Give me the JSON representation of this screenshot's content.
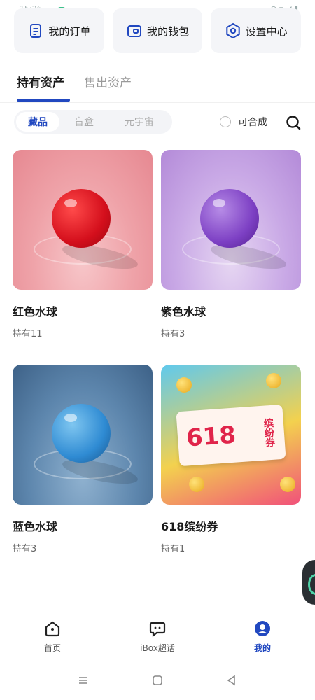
{
  "status_bar": {
    "time": "15:26",
    "right": "⊙ ▾ ◢ ▮"
  },
  "quick_actions": [
    {
      "label": "我的订单",
      "icon": "order-list-icon"
    },
    {
      "label": "我的钱包",
      "icon": "wallet-icon"
    },
    {
      "label": "设置中心",
      "icon": "settings-icon"
    }
  ],
  "asset_tabs": [
    {
      "label": "持有资产",
      "active": true
    },
    {
      "label": "售出资产",
      "active": false
    }
  ],
  "categories": [
    {
      "label": "藏品",
      "active": true
    },
    {
      "label": "盲盒",
      "active": false
    },
    {
      "label": "元宇宙",
      "active": false
    }
  ],
  "combine_filter": {
    "label": "可合成",
    "checked": false
  },
  "items": [
    {
      "title": "红色水球",
      "holding": "持有11",
      "image": "red-water-balloon"
    },
    {
      "title": "紫色水球",
      "holding": "持有3",
      "image": "purple-water-balloon"
    },
    {
      "title": "蓝色水球",
      "holding": "持有3",
      "image": "blue-water-balloon"
    },
    {
      "title": "618缤纷券",
      "holding": "持有1",
      "image": "618-coupon"
    }
  ],
  "coupon_art": {
    "big": "618",
    "side": "缤纷券"
  },
  "bottom_nav": [
    {
      "label": "首页",
      "icon": "home-icon",
      "active": false
    },
    {
      "label": "iBox超话",
      "icon": "chat-bubble-icon",
      "active": false
    },
    {
      "label": "我的",
      "icon": "profile-icon",
      "active": true
    }
  ],
  "colors": {
    "accent": "#2148c0",
    "text": "#1a1a1a",
    "muted": "#999999"
  }
}
